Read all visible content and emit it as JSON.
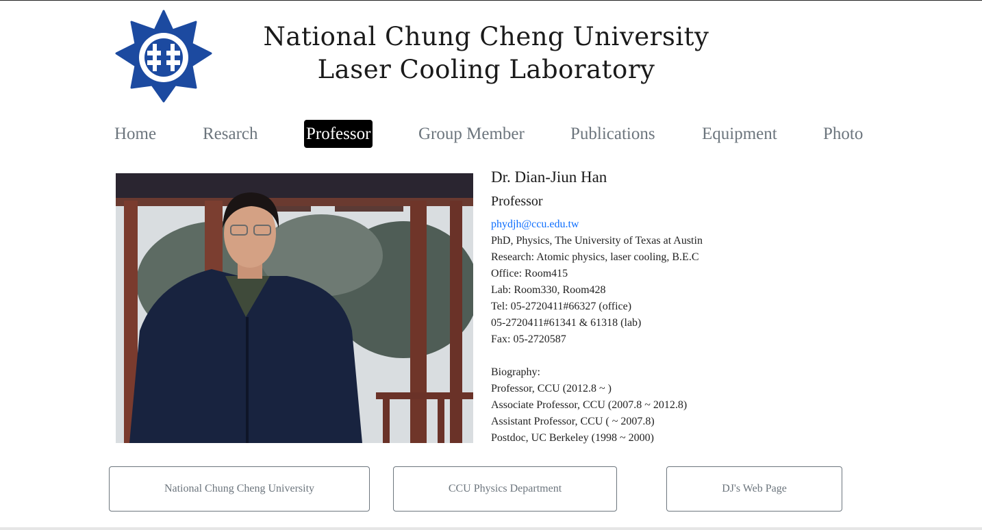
{
  "header": {
    "title_line1": "National Chung Cheng University",
    "title_line2": "Laser Cooling Laboratory"
  },
  "nav": {
    "items": [
      {
        "label": "Home"
      },
      {
        "label": "Resarch"
      },
      {
        "label": "Professor"
      },
      {
        "label": "Group Member"
      },
      {
        "label": "Publications"
      },
      {
        "label": "Equipment"
      },
      {
        "label": "Photo"
      }
    ],
    "active": "Professor"
  },
  "profile": {
    "name": "Dr. Dian-Jiun Han",
    "title": "Professor",
    "email": "phydjh@ccu.edu.tw",
    "details": [
      "PhD, Physics, The University of Texas at Austin",
      "Research: Atomic physics, laser cooling, B.E.C",
      "Office: Room415",
      "Lab: Room330, Room428",
      "Tel: 05-2720411#66327 (office)",
      "05-2720411#61341 & 61318 (lab)",
      "Fax: 05-2720587"
    ],
    "biography_heading": "Biography:",
    "biography": [
      "Professor, CCU (2012.8 ~ )",
      "Associate Professor, CCU (2007.8 ~ 2012.8)",
      "Assistant Professor, CCU ( ~ 2007.8)",
      "Postdoc, UC Berkeley (1998 ~ 2000)"
    ]
  },
  "footer_links": [
    {
      "label": "National Chung Cheng University"
    },
    {
      "label": "CCU Physics Department"
    },
    {
      "label": "DJ's Web Page"
    }
  ],
  "colors": {
    "logo_blue": "#1c4aa0",
    "nav_text": "#6c757d",
    "nav_active_bg": "#000000",
    "link": "#0d6efd"
  }
}
